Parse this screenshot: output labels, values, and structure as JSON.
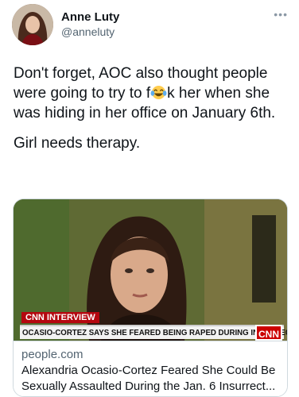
{
  "author": {
    "name": "Anne Luty",
    "handle": "@anneluty"
  },
  "tweet": {
    "line1_before_emoji": "Don't forget, AOC also thought people were going to try to f",
    "line1_after_emoji": "k her when she was hiding in her office on January 6th.",
    "emoji": "face-with-tears-of-joy",
    "line2": "Girl needs therapy."
  },
  "card": {
    "chyron_tag": "CNN INTERVIEW",
    "chyron_text": "OCASIO-CORTEZ SAYS SHE FEARED BEING RAPED DURING INSURRECTION",
    "network_logo": "CNN",
    "domain": "people.com",
    "title_line1": "Alexandria Ocasio-Cortez Feared She Could Be",
    "title_line2": "Sexually Assaulted During the Jan. 6 Insurrect..."
  },
  "colors": {
    "text": "#0f1419",
    "secondary": "#536471",
    "border": "#cfd9de",
    "cnn_red": "#cc0000"
  }
}
